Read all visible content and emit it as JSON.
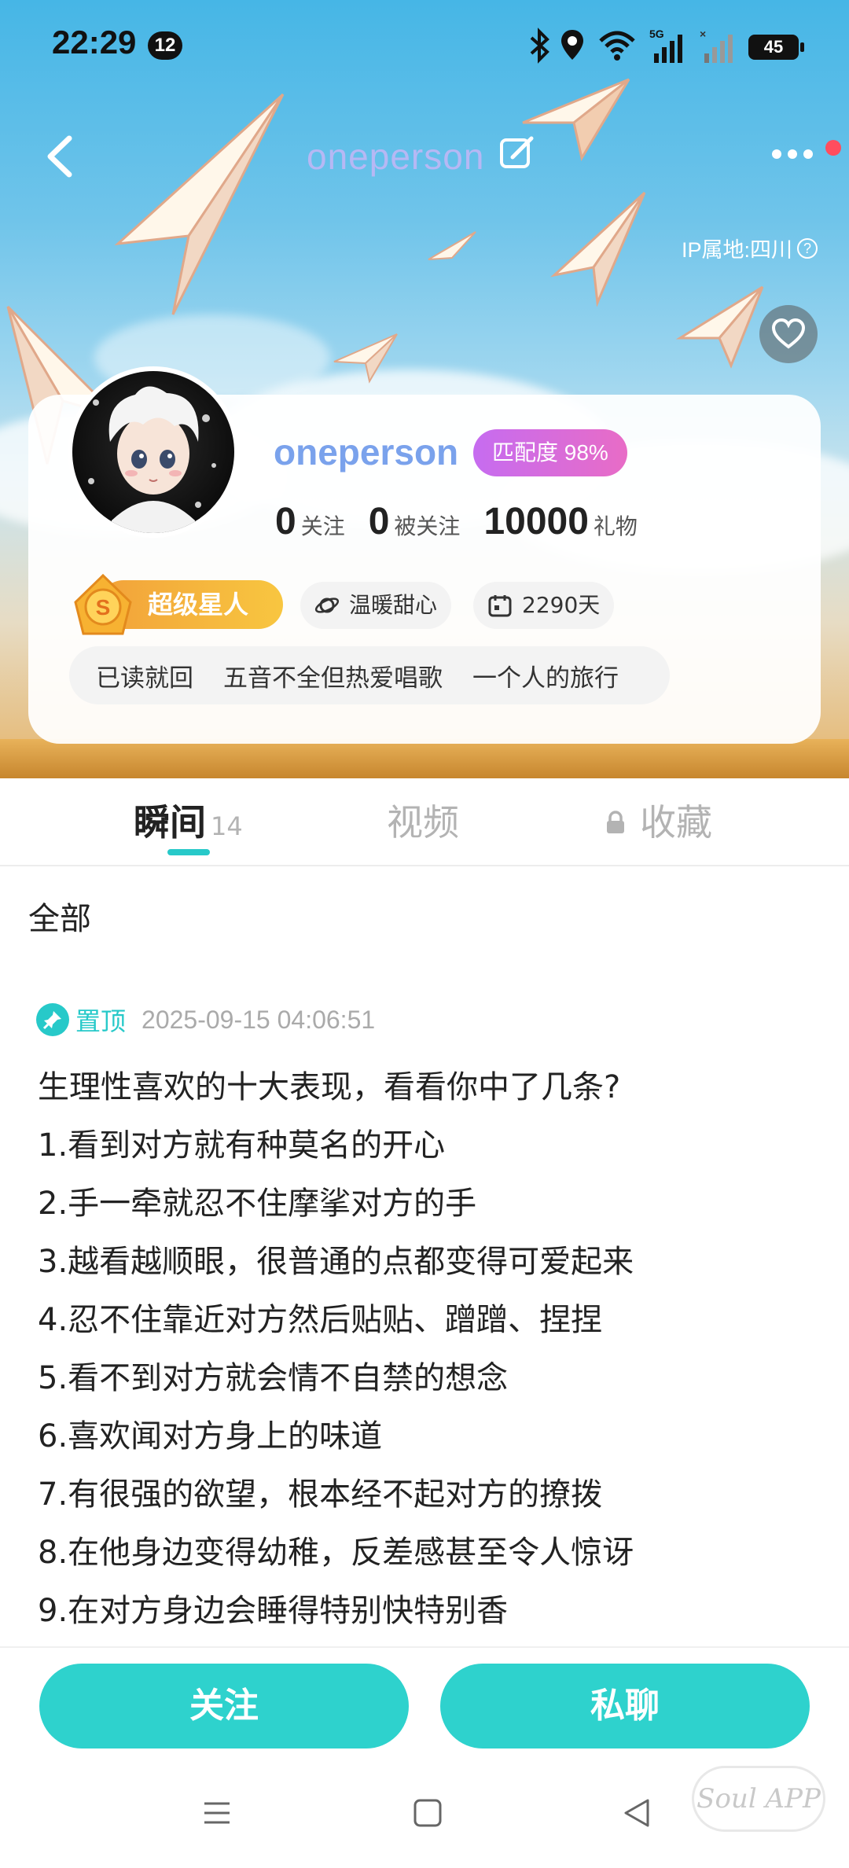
{
  "status_bar": {
    "time": "22:29",
    "notification_count": "12",
    "network": "5G",
    "battery": "45"
  },
  "nav": {
    "title": "oneperson",
    "ip_location": "IP属地:四川"
  },
  "profile": {
    "username": "oneperson",
    "match": "匹配度 98%",
    "stats": [
      {
        "value": "0",
        "label": "关注"
      },
      {
        "value": "0",
        "label": "被关注"
      },
      {
        "value": "10000",
        "label": "礼物"
      }
    ],
    "vip_label": "超级星人",
    "tags": [
      {
        "icon": "planet-icon",
        "label": "温暖甜心"
      },
      {
        "icon": "calendar-icon",
        "label": "2290天"
      }
    ],
    "interests": [
      "已读就回",
      "五音不全但热爱唱歌",
      "一个人的旅行"
    ]
  },
  "tabs": [
    {
      "label": "瞬间",
      "count": "14",
      "active": true
    },
    {
      "label": "视频",
      "count": "",
      "active": false
    },
    {
      "label": "收藏",
      "count": "",
      "active": false,
      "locked": true
    }
  ],
  "feed": {
    "filter": "全部",
    "post": {
      "pinned_label": "置顶",
      "timestamp": "2025-09-15 04:06:51",
      "lines": [
        "生理性喜欢的十大表现，看看你中了几条?",
        "1.看到对方就有种莫名的开心",
        "2.手一牵就忍不住摩挲对方的手",
        "3.越看越顺眼，很普通的点都变得可爱起来",
        "4.忍不住靠近对方然后贴贴、蹭蹭、捏捏",
        "5.看不到对方就会情不自禁的想念",
        "6.喜欢闻对方身上的味道",
        "7.有很强的欲望，根本经不起对方的撩拨",
        "8.在他身边变得幼稚，反差感甚至令人惊讶",
        "9.在对方身边会睡得特别快特别香"
      ]
    }
  },
  "actions": {
    "follow": "关注",
    "chat": "私聊"
  },
  "watermark": "Soul APP",
  "colors": {
    "accent": "#2ed2cd",
    "username": "#7aa2ec",
    "match_badge": "#d56cdc",
    "vip": "#f5b43c"
  }
}
